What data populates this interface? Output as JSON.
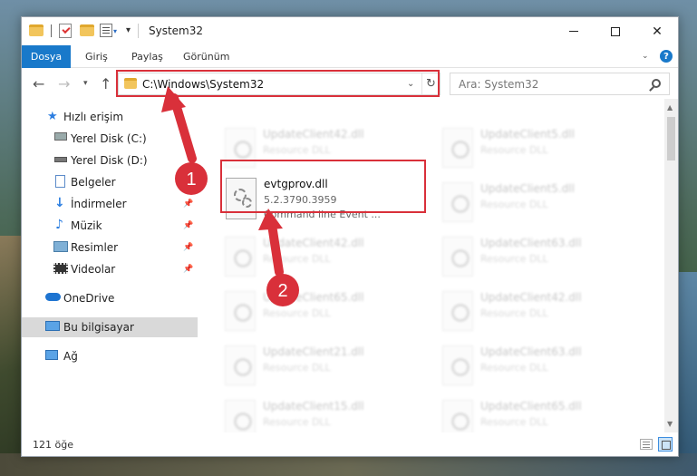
{
  "window": {
    "title": "System32"
  },
  "ribbon": {
    "tabs": [
      "Dosya",
      "Giriş",
      "Paylaş",
      "Görünüm"
    ]
  },
  "address": {
    "path": "C:\\Windows\\System32",
    "search_placeholder": "Ara: System32"
  },
  "sidebar": {
    "quick_access": "Hızlı erişim",
    "items": [
      {
        "label": "Yerel Disk (C:)",
        "icon": "drive-icon",
        "pinned": false
      },
      {
        "label": "Yerel Disk (D:)",
        "icon": "drive-icon",
        "pinned": false
      },
      {
        "label": "Belgeler",
        "icon": "documents-icon",
        "pinned": false
      },
      {
        "label": "İndirmeler",
        "icon": "download-icon",
        "pinned": true
      },
      {
        "label": "Müzik",
        "icon": "music-icon",
        "pinned": true
      },
      {
        "label": "Resimler",
        "icon": "pictures-icon",
        "pinned": true
      },
      {
        "label": "Videolar",
        "icon": "videos-icon",
        "pinned": true
      }
    ],
    "onedrive": "OneDrive",
    "this_pc": "Bu bilgisayar",
    "network": "Ağ"
  },
  "files": {
    "left_column": [
      {
        "name": "UpdateClient42.dll",
        "type": "Resource DLL"
      },
      {
        "name": "UpdateClient42.dll",
        "type": "Resource DLL"
      },
      {
        "name": "UpdateClient65.dll",
        "type": "Resource DLL"
      },
      {
        "name": "UpdateClient21.dll",
        "type": "Resource DLL"
      },
      {
        "name": "UpdateClient15.dll",
        "type": "Resource DLL"
      }
    ],
    "right_column": [
      {
        "name": "UpdateClient5.dll",
        "type": "Resource DLL"
      },
      {
        "name": "UpdateClient5.dll",
        "type": "Resource DLL"
      },
      {
        "name": "UpdateClient63.dll",
        "type": "Resource DLL"
      },
      {
        "name": "UpdateClient42.dll",
        "type": "Resource DLL"
      },
      {
        "name": "UpdateClient63.dll",
        "type": "Resource DLL"
      },
      {
        "name": "UpdateClient65.dll",
        "type": "Resource DLL"
      }
    ],
    "highlighted": {
      "name": "evtgprov.dll",
      "version": "5.2.3790.3959",
      "description": "Command line Event ..."
    }
  },
  "status": {
    "item_count": "121 öğe"
  },
  "annotations": {
    "step1": "1",
    "step2": "2",
    "color": "#d9303a"
  }
}
